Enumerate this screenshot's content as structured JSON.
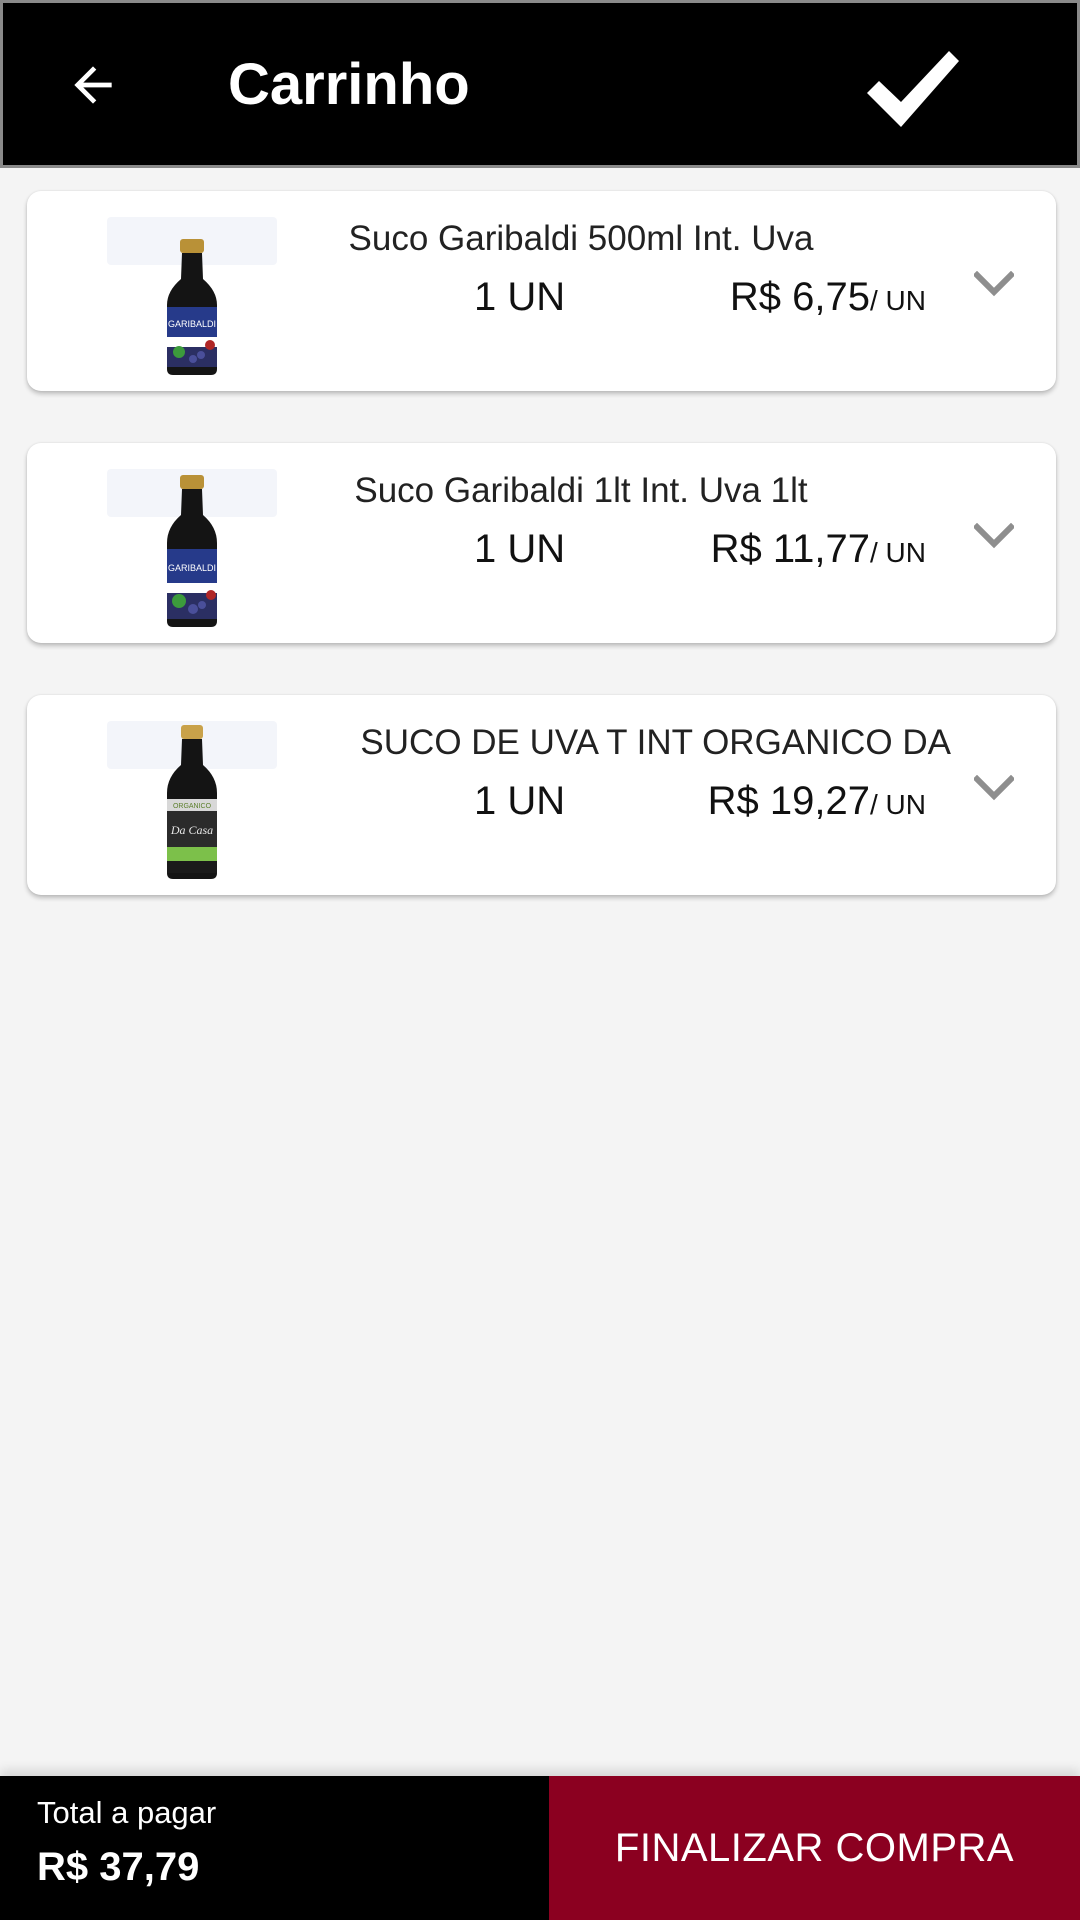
{
  "app_bar": {
    "title": "Carrinho",
    "back_icon": "arrow-left-icon",
    "confirm_icon": "check-icon"
  },
  "cart": {
    "items": [
      {
        "name": "Suco Garibaldi 500ml Int. Uva",
        "quantity": "1 UN",
        "price": "R$ 6,75",
        "unit": "/ UN",
        "image_icon": "juice-bottle-icon",
        "expand_icon": "chevron-down-icon"
      },
      {
        "name": "Suco Garibaldi 1lt Int. Uva 1lt",
        "quantity": "1 UN",
        "price": "R$ 11,77",
        "unit": "/ UN",
        "image_icon": "juice-bottle-icon",
        "expand_icon": "chevron-down-icon"
      },
      {
        "name": "SUCO DE UVA T INT ORGANICO DA",
        "quantity": "1 UN",
        "price": "R$ 19,27",
        "unit": "/ UN",
        "image_icon": "juice-bottle-icon",
        "expand_icon": "chevron-down-icon"
      }
    ]
  },
  "footer": {
    "total_label": "Total a pagar",
    "total_value": "R$ 37,79",
    "checkout_label": "FINALIZAR COMPRA"
  },
  "colors": {
    "app_bar_bg": "#000000",
    "checkout_bg": "#8b0020",
    "page_bg": "#f4f4f4",
    "card_bg": "#ffffff",
    "chevron": "#8e8e8e"
  }
}
